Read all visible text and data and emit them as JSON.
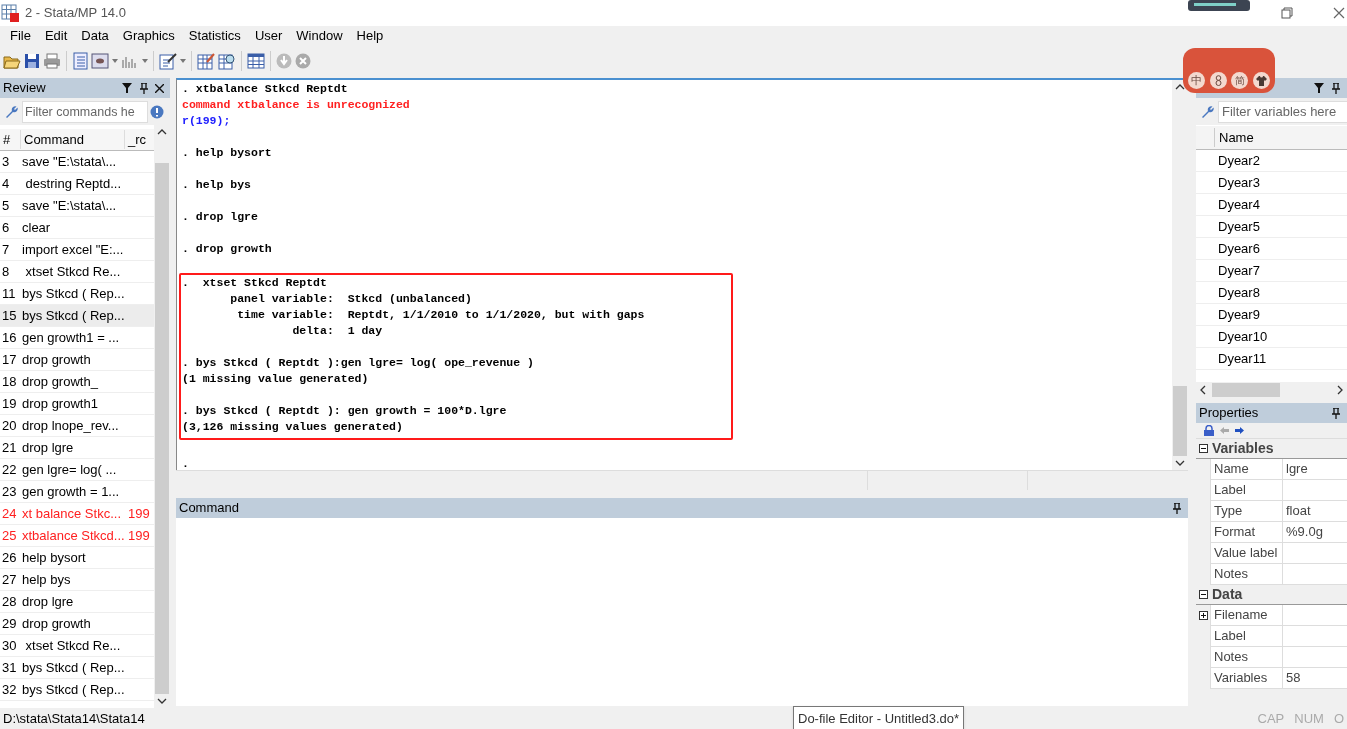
{
  "window": {
    "title": "2 - Stata/MP 14.0"
  },
  "menu": [
    "File",
    "Edit",
    "Data",
    "Graphics",
    "Statistics",
    "User",
    "Window",
    "Help"
  ],
  "ime_toolbar": {
    "items": [
      "中",
      "简"
    ]
  },
  "review": {
    "title": "Review",
    "filter_placeholder": "Filter commands he",
    "columns": [
      "#",
      "Command",
      "_rc"
    ],
    "rows": [
      {
        "num": "3",
        "command": "save \"E:\\stata\\...",
        "rc": "",
        "failed": false,
        "selected": false
      },
      {
        "num": "4",
        "command": " destring Reptd...",
        "rc": "",
        "failed": false,
        "selected": false
      },
      {
        "num": "5",
        "command": "save \"E:\\stata\\...",
        "rc": "",
        "failed": false,
        "selected": false
      },
      {
        "num": "6",
        "command": "clear",
        "rc": "",
        "failed": false,
        "selected": false
      },
      {
        "num": "7",
        "command": "import excel \"E:...",
        "rc": "",
        "failed": false,
        "selected": false
      },
      {
        "num": "8",
        "command": " xtset Stkcd Re...",
        "rc": "",
        "failed": false,
        "selected": false
      },
      {
        "num": "11",
        "command": "bys Stkcd ( Rep...",
        "rc": "",
        "failed": false,
        "selected": false
      },
      {
        "num": "15",
        "command": "bys Stkcd ( Rep...",
        "rc": "",
        "failed": false,
        "selected": true
      },
      {
        "num": "16",
        "command": "gen growth1 = ...",
        "rc": "",
        "failed": false,
        "selected": false
      },
      {
        "num": "17",
        "command": "drop growth",
        "rc": "",
        "failed": false,
        "selected": false
      },
      {
        "num": "18",
        "command": "drop growth_",
        "rc": "",
        "failed": false,
        "selected": false
      },
      {
        "num": "19",
        "command": "drop growth1",
        "rc": "",
        "failed": false,
        "selected": false
      },
      {
        "num": "20",
        "command": "drop lnope_rev...",
        "rc": "",
        "failed": false,
        "selected": false
      },
      {
        "num": "21",
        "command": "drop lgre",
        "rc": "",
        "failed": false,
        "selected": false
      },
      {
        "num": "22",
        "command": "gen lgre= log( ...",
        "rc": "",
        "failed": false,
        "selected": false
      },
      {
        "num": "23",
        "command": "gen growth = 1...",
        "rc": "",
        "failed": false,
        "selected": false
      },
      {
        "num": "24",
        "command": "xt balance Stkc...",
        "rc": "199",
        "failed": true,
        "selected": false
      },
      {
        "num": "25",
        "command": "xtbalance Stkcd...",
        "rc": "199",
        "failed": true,
        "selected": false
      },
      {
        "num": "26",
        "command": "help bysort",
        "rc": "",
        "failed": false,
        "selected": false
      },
      {
        "num": "27",
        "command": "help bys",
        "rc": "",
        "failed": false,
        "selected": false
      },
      {
        "num": "28",
        "command": "drop lgre",
        "rc": "",
        "failed": false,
        "selected": false
      },
      {
        "num": "29",
        "command": "drop growth",
        "rc": "",
        "failed": false,
        "selected": false
      },
      {
        "num": "30",
        "command": " xtset Stkcd Re...",
        "rc": "",
        "failed": false,
        "selected": false
      },
      {
        "num": "31",
        "command": "bys Stkcd ( Rep...",
        "rc": "",
        "failed": false,
        "selected": false
      },
      {
        "num": "32",
        "command": "bys Stkcd ( Rep...",
        "rc": "",
        "failed": false,
        "selected": false
      }
    ]
  },
  "results": {
    "sections": [
      {
        "boxed": false,
        "lines": [
          {
            "kind": "command",
            "text": ". xtbalance Stkcd Reptdt"
          },
          {
            "kind": "error",
            "text": "command xtbalance is unrecognized"
          },
          {
            "kind": "return_code",
            "text": "r(199);"
          },
          {
            "kind": "spacer"
          },
          {
            "kind": "command",
            "text": ". help bysort"
          },
          {
            "kind": "spacer"
          },
          {
            "kind": "command",
            "text": ". help bys"
          },
          {
            "kind": "spacer"
          },
          {
            "kind": "command",
            "text": ". drop lgre"
          },
          {
            "kind": "spacer"
          },
          {
            "kind": "command",
            "text": ". drop growth"
          },
          {
            "kind": "spacer"
          }
        ]
      },
      {
        "boxed": true,
        "lines": [
          {
            "kind": "command",
            "text": ".  xtset Stkcd Reptdt"
          },
          {
            "kind": "output",
            "text": "       panel variable:  Stkcd (unbalanced)"
          },
          {
            "kind": "output",
            "text": "        time variable:  Reptdt, 1/1/2010 to 1/1/2020, but with gaps"
          },
          {
            "kind": "output",
            "text": "                delta:  1 day"
          },
          {
            "kind": "spacer"
          },
          {
            "kind": "command",
            "text": ". bys Stkcd ( Reptdt ):gen lgre= log( ope_revenue )"
          },
          {
            "kind": "output",
            "text": "(1 missing value generated)"
          },
          {
            "kind": "spacer"
          },
          {
            "kind": "command",
            "text": ". bys Stkcd ( Reptdt ): gen growth = 100*D.lgre"
          },
          {
            "kind": "output",
            "text": "(3,126 missing values generated)"
          }
        ]
      },
      {
        "boxed": false,
        "lines": [
          {
            "kind": "spacer"
          },
          {
            "kind": "output",
            "text": "."
          }
        ]
      }
    ]
  },
  "command_panel": {
    "title": "Command"
  },
  "variables": {
    "filter_placeholder": "Filter variables here",
    "column": "Name",
    "rows": [
      "Dyear2",
      "Dyear3",
      "Dyear4",
      "Dyear5",
      "Dyear6",
      "Dyear7",
      "Dyear8",
      "Dyear9",
      "Dyear10",
      "Dyear11"
    ]
  },
  "properties": {
    "title": "Properties",
    "groups": [
      {
        "name": "Variables",
        "expanded": true,
        "rows": [
          {
            "label": "Name",
            "value": "lgre",
            "expandable": false
          },
          {
            "label": "Label",
            "value": "",
            "expandable": false
          },
          {
            "label": "Type",
            "value": "float",
            "expandable": false
          },
          {
            "label": "Format",
            "value": "%9.0g",
            "expandable": false
          },
          {
            "label": "Value label",
            "value": "",
            "expandable": false
          },
          {
            "label": "Notes",
            "value": "",
            "expandable": false
          }
        ]
      },
      {
        "name": "Data",
        "expanded": true,
        "rows": [
          {
            "label": "Filename",
            "value": "",
            "expandable": true
          },
          {
            "label": "Label",
            "value": "",
            "expandable": false
          },
          {
            "label": "Notes",
            "value": "",
            "expandable": false
          },
          {
            "label": "Variables",
            "value": "58",
            "expandable": false
          }
        ]
      }
    ]
  },
  "status_bar": {
    "path": "D:\\stata\\Stata14\\Stata14",
    "indicators": [
      "CAP",
      "NUM",
      "O"
    ]
  },
  "tooltip": "Do-file Editor - Untitled3.do*"
}
